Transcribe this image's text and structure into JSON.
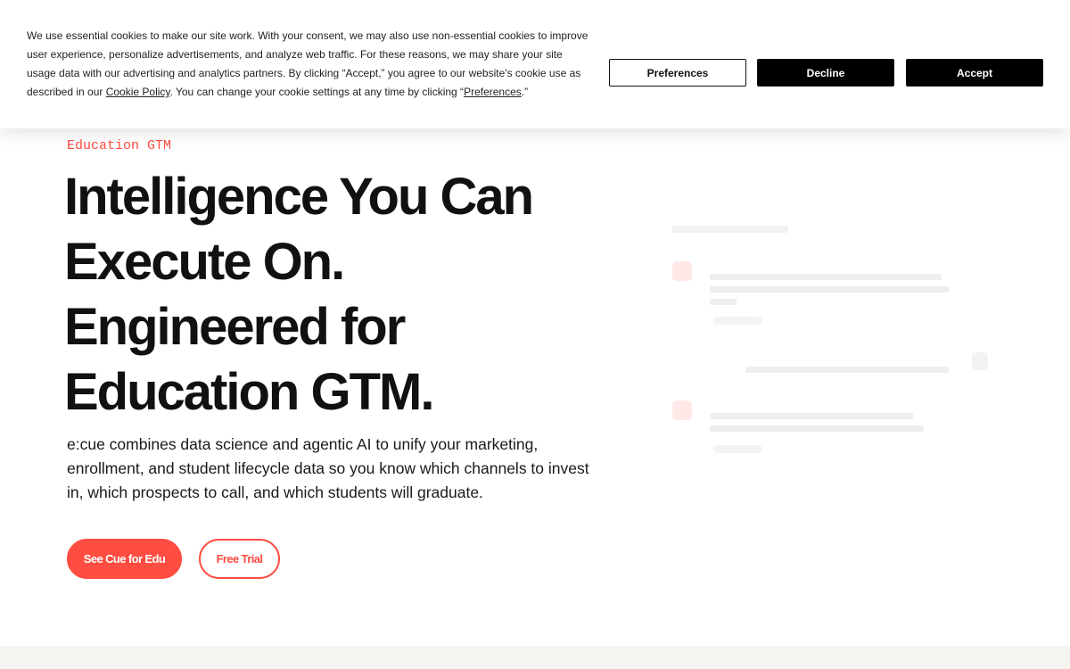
{
  "cookie_banner": {
    "text_before_link": "We use essential cookies to make our site work. With your consent, we may also use non-essential cookies to improve user experience, personalize advertisements, and analyze web traffic. For these reasons, we may share your site usage data with our advertising and analytics partners. By clicking “Accept,” you agree to our website's cookie use as described in our ",
    "cookie_policy_link": "Cookie Policy",
    "text_middle": ". You can change your cookie settings at any time by clicking “",
    "preferences_link": "Preferences",
    "text_end": ".”",
    "preferences_button": "Preferences",
    "decline_button": "Decline",
    "accept_button": "Accept"
  },
  "hero": {
    "eyebrow": "Education GTM",
    "headline_lines": [
      "Intelligence You Can",
      "Execute On.",
      "Engineered for",
      "Education GTM."
    ],
    "subtext": "e:cue combines data science and agentic AI to unify your marketing, enrollment, and student lifecycle data so you know which channels to invest in, which prospects to call, and which students will graduate.",
    "primary_cta": "See Cue for Edu",
    "secondary_cta": "Free Trial"
  },
  "colors": {
    "accent": "#ff4d42",
    "text": "#111111",
    "banner_button_dark": "#000000",
    "bottom_band": "#f4f4f1"
  }
}
